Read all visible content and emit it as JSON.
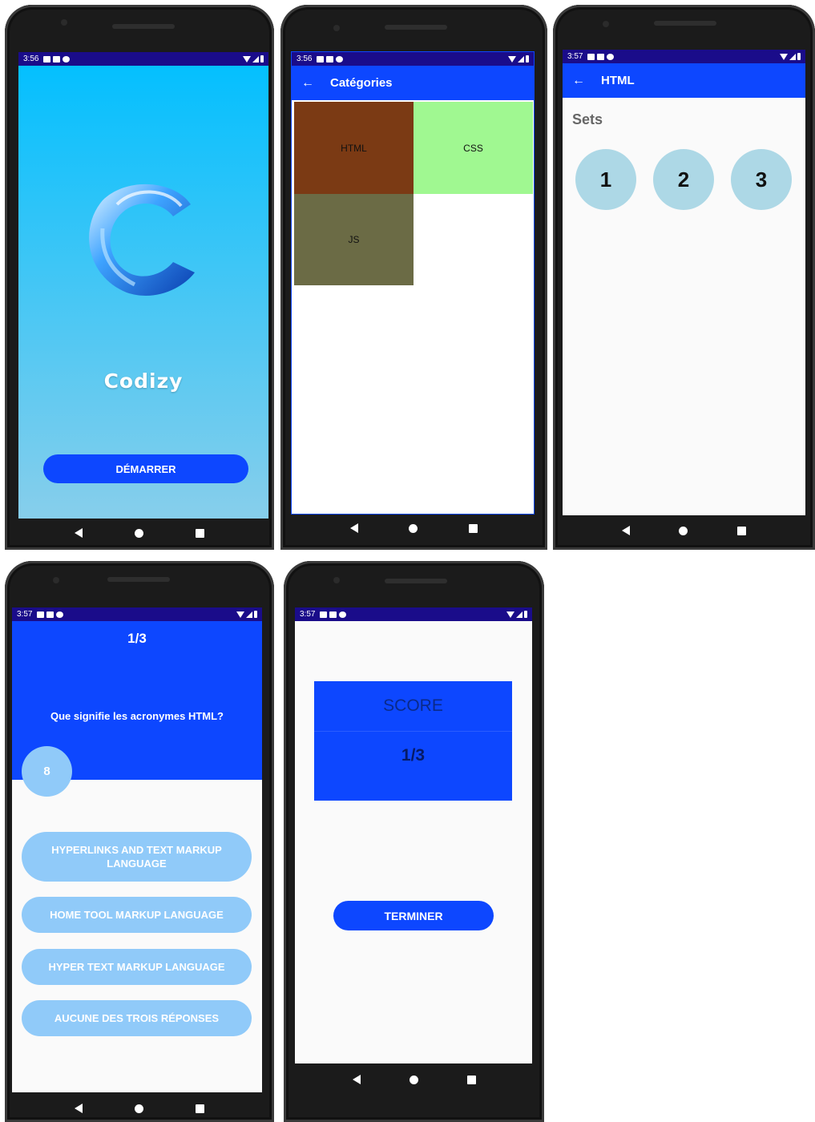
{
  "colors": {
    "status_bar": "#1a0c8a",
    "primary": "#0d47ff",
    "splash_top": "#00bfff",
    "splash_bottom": "#87ceeb",
    "html_tile": "#7b3a14",
    "css_tile": "#a0f891",
    "js_tile": "#6b6b45",
    "set_circle": "#add8e6",
    "answer_button": "#90caf9"
  },
  "icons": {
    "back": "arrow-left-icon",
    "nav_back": "triangle-back-icon",
    "nav_home": "circle-home-icon",
    "nav_recent": "square-recent-icon"
  },
  "screen1": {
    "time": "3:56",
    "app_name": "Codizy",
    "start_label": "DÉMARRER"
  },
  "screen2": {
    "time": "3:56",
    "title": "Catégories",
    "tiles": [
      "HTML",
      "CSS",
      "JS"
    ]
  },
  "screen3": {
    "time": "3:57",
    "title": "HTML",
    "section_label": "Sets",
    "sets": [
      "1",
      "2",
      "3"
    ]
  },
  "screen4": {
    "time": "3:57",
    "progress": "1/3",
    "question": "Que signifie les acronymes HTML?",
    "timer": "8",
    "answers": [
      "HYPERLINKS AND TEXT MARKUP LANGUAGE",
      "HOME TOOL MARKUP LANGUAGE",
      "HYPER TEXT MARKUP LANGUAGE",
      "AUCUNE DES TROIS RÉPONSES"
    ]
  },
  "screen5": {
    "time": "3:57",
    "score_label": "SCORE",
    "score_value": "1/3",
    "finish_label": "TERMINER"
  }
}
